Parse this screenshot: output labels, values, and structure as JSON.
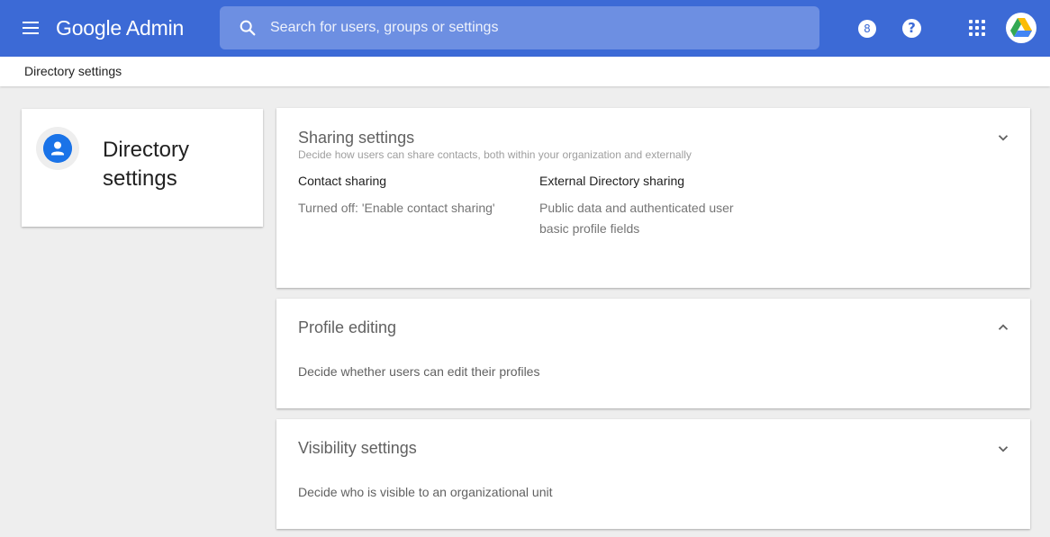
{
  "app": {
    "name": "Google Admin",
    "search_placeholder": "Search for users, groups or settings",
    "notification_count": "8",
    "help_glyph": "?"
  },
  "breadcrumb": {
    "current": "Directory settings"
  },
  "page": {
    "title": "Directory settings"
  },
  "sections": {
    "sharing": {
      "title": "Sharing settings",
      "subtitle": "Decide how users can share contacts, both within your organization and externally",
      "contact_sharing_label": "Contact sharing",
      "contact_sharing_value": "Turned off: 'Enable contact sharing'",
      "external_label": "External Directory sharing",
      "external_value_line1": "Public data and authenticated user",
      "external_value_line2": "basic profile fields"
    },
    "profile_editing": {
      "title": "Profile editing",
      "description": "Decide whether users can edit their profiles"
    },
    "visibility": {
      "title": "Visibility settings",
      "description": "Decide who is visible to an organizational unit"
    }
  },
  "icons": {
    "menu": "menu-icon",
    "search": "search-icon",
    "help": "help-icon",
    "apps": "apps-grid-icon",
    "directory": "person-icon",
    "expand": "chevron-down-icon",
    "collapse": "chevron-up-icon"
  },
  "colors": {
    "header": "#3c6ad6",
    "search_bg": "#6d8fe2",
    "accent": "#1a73e8",
    "page_bg": "#eeeeee"
  }
}
